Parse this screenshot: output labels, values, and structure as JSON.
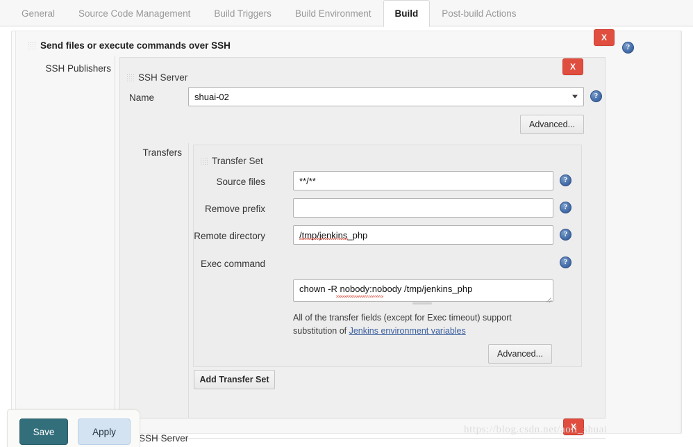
{
  "tabs": [
    {
      "label": "General",
      "active": false
    },
    {
      "label": "Source Code Management",
      "active": false
    },
    {
      "label": "Build Triggers",
      "active": false
    },
    {
      "label": "Build Environment",
      "active": false
    },
    {
      "label": "Build",
      "active": true
    },
    {
      "label": "Post-build Actions",
      "active": false
    }
  ],
  "builder": {
    "title": "Send files or execute commands over SSH",
    "delete_label": "X",
    "help_label": "?",
    "publishers_label": "SSH Publishers"
  },
  "ssh_server": {
    "title": "SSH Server",
    "delete_label": "X",
    "name_label": "Name",
    "name_value": "shuai-02",
    "name_options": [
      "shuai-02"
    ],
    "help_label": "?",
    "advanced_label": "Advanced...",
    "transfers_label": "Transfers"
  },
  "transfer_set": {
    "title": "Transfer Set",
    "fields": [
      {
        "label": "Source files",
        "value": "**/**",
        "placeholder": ""
      },
      {
        "label": "Remove prefix",
        "value": "",
        "placeholder": ""
      },
      {
        "label": "Remote directory",
        "value": "/tmp/jenkins_php",
        "placeholder": ""
      }
    ],
    "exec_label": "Exec command",
    "exec_value": "chown -R nobody:nobody /tmp/jenkins_php",
    "help_label": "?",
    "note_text_1": "All of the transfer fields (except for Exec timeout) support substitution of ",
    "note_link": "Jenkins environment variables",
    "advanced_label": "Advanced...",
    "add_transfer_set_label": "Add Transfer Set"
  },
  "next_section": {
    "title": "SSH Server",
    "delete_label": "X"
  },
  "footer": {
    "save_label": "Save",
    "apply_label": "Apply"
  },
  "watermark": {
    "text": "https://blog.csdn.net/aoli_shuai"
  },
  "colors": {
    "accent_red": "#e04e3f",
    "help_blue": "#4a73ad",
    "save_teal": "#336e7b",
    "apply_blue": "#d4e3f2",
    "link_blue": "#3a5f9e"
  }
}
